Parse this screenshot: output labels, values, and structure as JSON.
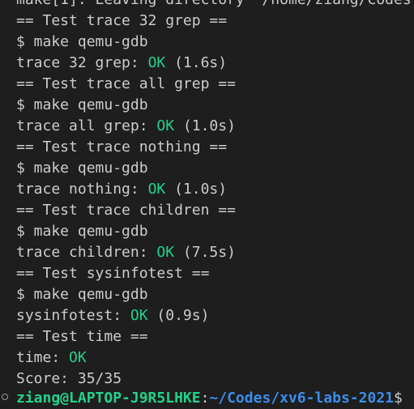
{
  "terminal": {
    "lines": [
      "make[1]: Leaving directory '/home/ziang/Codes",
      "== Test trace 32 grep ==",
      "$ make qemu-gdb",
      {
        "pre": "trace 32 grep: ",
        "ok": "OK",
        "post": " (1.6s)"
      },
      "== Test trace all grep ==",
      "$ make qemu-gdb",
      {
        "pre": "trace all grep: ",
        "ok": "OK",
        "post": " (1.0s)"
      },
      "== Test trace nothing ==",
      "$ make qemu-gdb",
      {
        "pre": "trace nothing: ",
        "ok": "OK",
        "post": " (1.0s)"
      },
      "== Test trace children ==",
      "$ make qemu-gdb",
      {
        "pre": "trace children: ",
        "ok": "OK",
        "post": " (7.5s)"
      },
      "== Test sysinfotest ==",
      "$ make qemu-gdb",
      {
        "pre": "sysinfotest: ",
        "ok": "OK",
        "post": " (0.9s)"
      },
      "== Test time ==",
      {
        "pre": "time: ",
        "ok": "OK",
        "post": ""
      },
      "Score: 35/35"
    ],
    "prompt": {
      "user_host": "ziang@LAPTOP-J9R5LHKE",
      "separator": ":",
      "path": "~/Codes/xv6-labs-2021",
      "symbol": "$"
    },
    "colors": {
      "background": "#1e1e1e",
      "text": "#cccccc",
      "ok": "#23d18b",
      "user": "#23d18b",
      "path": "#3b8eea"
    }
  }
}
